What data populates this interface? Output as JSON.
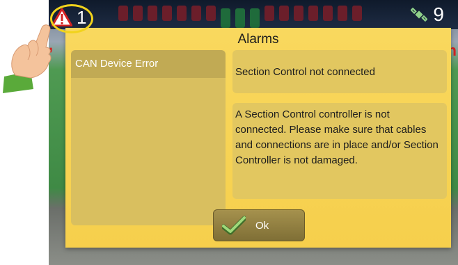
{
  "status_bar": {
    "alarm_count": "1",
    "satellite_count": "9"
  },
  "dialog": {
    "title": "Alarms",
    "alarm_list": [
      {
        "label": "CAN Device Error",
        "selected": true
      }
    ],
    "detail_title": "Section Control not connected",
    "detail_body": "A Section Control controller is not connected. Please make sure that cables and connections are in place and/or Section Controller is not damaged.",
    "ok_label": "Ok"
  },
  "colors": {
    "dialog_background": "#f9d85e",
    "selected_item": "#c1aa54",
    "highlight_ring": "#f1d31c",
    "warning_red": "#d32222"
  },
  "icons": {
    "alarm": "warning-triangle-icon",
    "gps": "satellite-icon",
    "ok": "checkmark-icon",
    "pointer": "pointing-hand-icon"
  }
}
